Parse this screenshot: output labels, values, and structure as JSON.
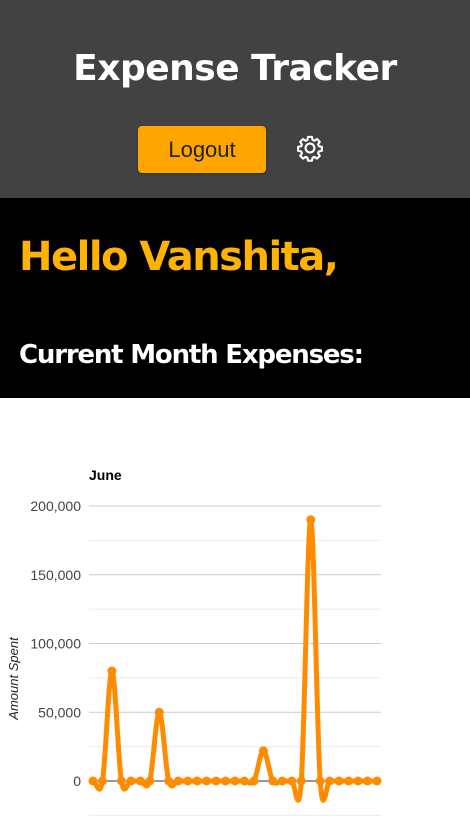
{
  "header": {
    "title": "Expense Tracker",
    "logout_label": "Logout",
    "settings_icon": "gear-icon"
  },
  "banner": {
    "greeting": "Hello Vanshita,",
    "section_heading": "Current Month Expenses:"
  },
  "colors": {
    "header_bg": "#424242",
    "banner_bg": "#000000",
    "accent": "#ffa500",
    "greeting": "#ffb300",
    "line": "#ff8c00"
  },
  "chart_data": {
    "type": "line",
    "title": "June",
    "ylabel": "Amount Spent",
    "xlabel": "",
    "ylim": [
      0,
      200000
    ],
    "yticks": [
      "0",
      "50,000",
      "100,000",
      "150,000",
      "200,000"
    ],
    "grid": true,
    "legend": "none",
    "series": [
      {
        "values": [
          0,
          0,
          80000,
          0,
          0,
          0,
          0,
          50000,
          0,
          0,
          0,
          0,
          0,
          0,
          0,
          0,
          0,
          0,
          22000,
          0,
          0,
          0,
          0,
          190000,
          0,
          0,
          0,
          0,
          0,
          0,
          0
        ]
      }
    ]
  }
}
